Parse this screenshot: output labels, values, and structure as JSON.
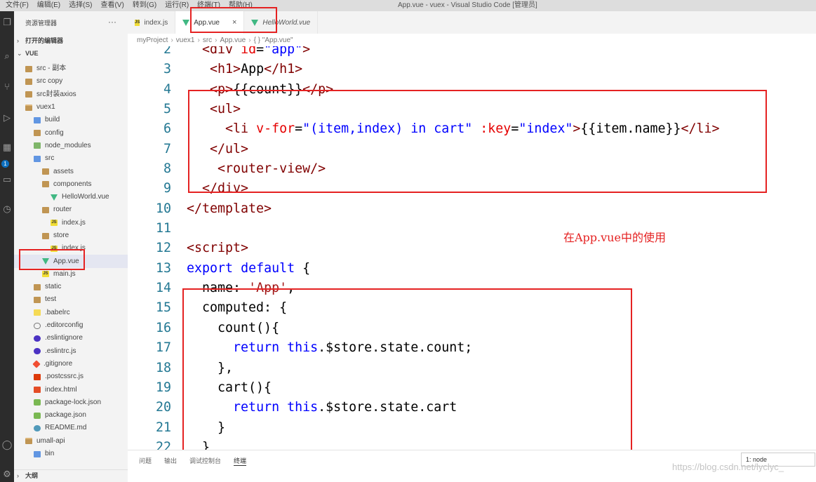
{
  "window": {
    "title": "App.vue - vuex - Visual Studio Code [管理员]",
    "menus": [
      "文件(F)",
      "编辑(E)",
      "选择(S)",
      "查看(V)",
      "转到(G)",
      "运行(R)",
      "终端(T)",
      "帮助(H)"
    ]
  },
  "sidebar": {
    "header": "资源管理器",
    "more": "···",
    "open_editors": "打开的编辑器",
    "workspace": "VUE",
    "outline": "大纲",
    "tree": [
      {
        "label": "src - 副本",
        "icon": "folder",
        "indent": 1
      },
      {
        "label": "src copy",
        "icon": "folder",
        "indent": 1
      },
      {
        "label": "src封装axios",
        "icon": "folder",
        "indent": 1
      },
      {
        "label": "vuex1",
        "icon": "folder-open",
        "indent": 1
      },
      {
        "label": "build",
        "icon": "folder-blue",
        "indent": 2
      },
      {
        "label": "config",
        "icon": "folder",
        "indent": 2
      },
      {
        "label": "node_modules",
        "icon": "folder-green",
        "indent": 2
      },
      {
        "label": "src",
        "icon": "folder-blue",
        "indent": 2
      },
      {
        "label": "assets",
        "icon": "folder",
        "indent": 3
      },
      {
        "label": "components",
        "icon": "folder",
        "indent": 3
      },
      {
        "label": "HelloWorld.vue",
        "icon": "vue",
        "indent": 4
      },
      {
        "label": "router",
        "icon": "folder",
        "indent": 3
      },
      {
        "label": "index.js",
        "icon": "js",
        "indent": 4
      },
      {
        "label": "store",
        "icon": "folder",
        "indent": 3
      },
      {
        "label": "index.js",
        "icon": "js",
        "indent": 4
      },
      {
        "label": "App.vue",
        "icon": "vue",
        "indent": 3,
        "selected": true
      },
      {
        "label": "main.js",
        "icon": "js",
        "indent": 3
      },
      {
        "label": "static",
        "icon": "folder",
        "indent": 2
      },
      {
        "label": "test",
        "icon": "folder",
        "indent": 2
      },
      {
        "label": ".babelrc",
        "icon": "babel",
        "indent": 2
      },
      {
        "label": ".editorconfig",
        "icon": "gear",
        "indent": 2
      },
      {
        "label": ".eslintignore",
        "icon": "eslint",
        "indent": 2
      },
      {
        "label": ".eslintrc.js",
        "icon": "eslint",
        "indent": 2
      },
      {
        "label": ".gitignore",
        "icon": "git",
        "indent": 2
      },
      {
        "label": ".postcssrc.js",
        "icon": "postcss",
        "indent": 2
      },
      {
        "label": "index.html",
        "icon": "html",
        "indent": 2
      },
      {
        "label": "package-lock.json",
        "icon": "npm",
        "indent": 2
      },
      {
        "label": "package.json",
        "icon": "npm",
        "indent": 2
      },
      {
        "label": "README.md",
        "icon": "info",
        "indent": 2
      },
      {
        "label": "umall-api",
        "icon": "folder-open",
        "indent": 1
      },
      {
        "label": "bin",
        "icon": "folder-blue",
        "indent": 2
      }
    ]
  },
  "tabs": [
    {
      "label": "index.js",
      "icon": "js",
      "active": false,
      "italic": false
    },
    {
      "label": "App.vue",
      "icon": "vue",
      "active": true,
      "italic": false,
      "close": "×"
    },
    {
      "label": "HelloWorld.vue",
      "icon": "vue",
      "active": false,
      "italic": true
    }
  ],
  "breadcrumb": [
    "myProject",
    "vuex1",
    "src",
    "App.vue",
    "{ } \"App.vue\""
  ],
  "code": [
    {
      "n": "2",
      "html": "  <span class='tok-tag'>&lt;div</span> <span class='tok-attr'>id</span>=<span class='tok-str'>\"app\"</span><span class='tok-tag'>&gt;</span>"
    },
    {
      "n": "3",
      "html": "   <span class='tok-tag'>&lt;h1&gt;</span>App<span class='tok-tag'>&lt;/h1&gt;</span>"
    },
    {
      "n": "4",
      "html": "   <span class='tok-tag'>&lt;p&gt;</span>{{count}}<span class='tok-tag'>&lt;/p&gt;</span>"
    },
    {
      "n": "5",
      "html": "   <span class='tok-tag'>&lt;ul&gt;</span>"
    },
    {
      "n": "6",
      "html": "     <span class='tok-tag'>&lt;li</span> <span class='tok-attr'>v-for</span>=<span class='tok-str'>\"(item,index) in cart\"</span> <span class='tok-attr'>:key</span>=<span class='tok-str'>\"index\"</span><span class='tok-tag'>&gt;</span>{{item.name}}<span class='tok-tag'>&lt;/li&gt;</span>"
    },
    {
      "n": "7",
      "html": "   <span class='tok-tag'>&lt;/ul&gt;</span>"
    },
    {
      "n": "8",
      "html": "    <span class='tok-tag'>&lt;router-view/&gt;</span>"
    },
    {
      "n": "9",
      "html": "  <span class='tok-tag'>&lt;/div&gt;</span>"
    },
    {
      "n": "10",
      "html": "<span class='tok-tag'>&lt;/template&gt;</span>"
    },
    {
      "n": "11",
      "html": ""
    },
    {
      "n": "12",
      "html": "<span class='tok-tag'>&lt;script&gt;</span>"
    },
    {
      "n": "13",
      "html": "<span class='tok-kw'>export</span> <span class='tok-kw'>default</span> {"
    },
    {
      "n": "14",
      "html": "  name: <span class='tok-strs'>'App'</span>,"
    },
    {
      "n": "15",
      "html": "  computed: {"
    },
    {
      "n": "16",
      "html": "    count(){"
    },
    {
      "n": "17",
      "html": "      <span class='tok-kw'>return</span> <span class='tok-kw'>this</span>.$store.state.count;"
    },
    {
      "n": "18",
      "html": "    },"
    },
    {
      "n": "19",
      "html": "    cart(){"
    },
    {
      "n": "20",
      "html": "      <span class='tok-kw'>return</span> <span class='tok-kw'>this</span>.$store.state.cart"
    },
    {
      "n": "21",
      "html": "    }"
    },
    {
      "n": "22",
      "html": "  }"
    }
  ],
  "annotation": "在App.vue中的使用",
  "panel": {
    "tabs": [
      "问题",
      "输出",
      "调试控制台",
      "终端"
    ],
    "active": "终端",
    "terminal_select": "1: node"
  },
  "watermark": "https://blog.csdn.net/lyclyc_"
}
